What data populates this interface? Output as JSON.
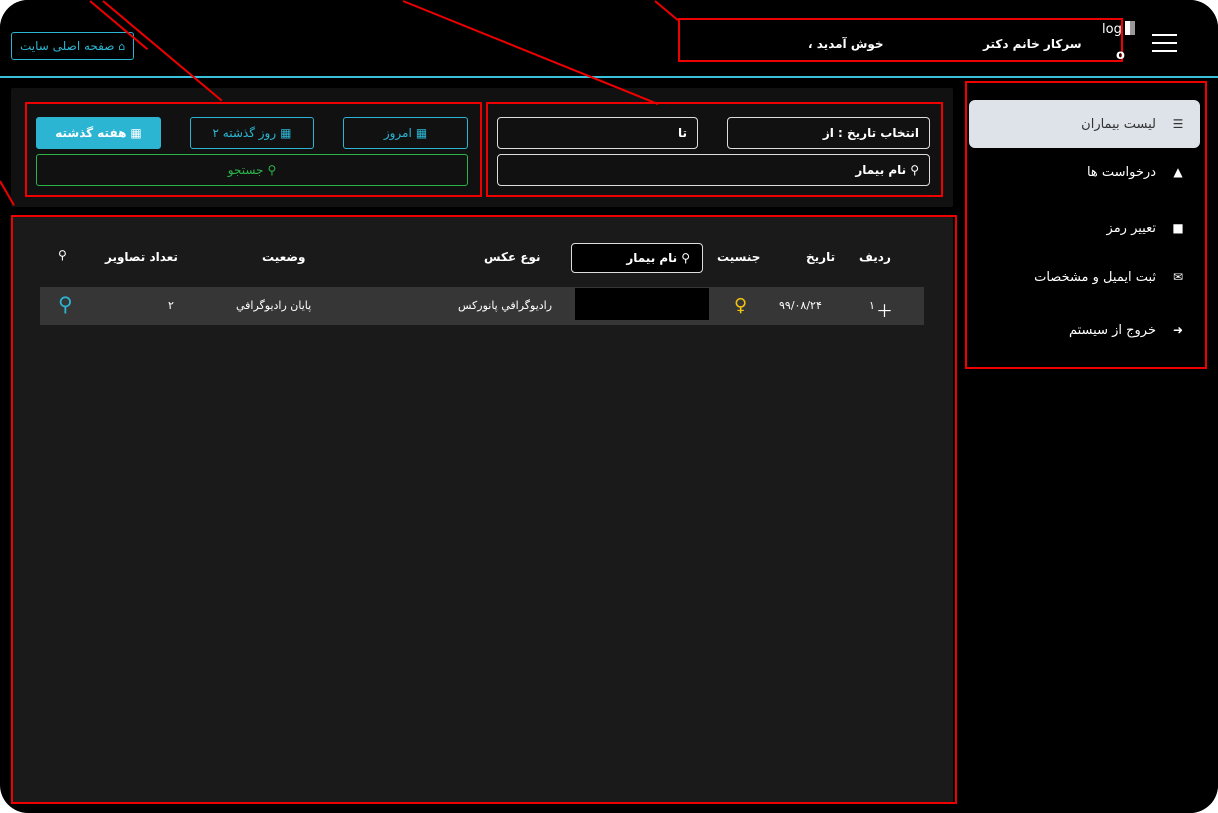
{
  "header": {
    "home_label": "صفحه اصلی سایت",
    "welcome": "، خوش آمدید",
    "user_name": "سرکار خانم دکتر",
    "logo_text": "log",
    "logo_o": "o"
  },
  "filters": {
    "date_from_label": "انتخاب تاریخ : از",
    "date_to_label": "تا",
    "patient_name_label": "نام بیمار",
    "today_label": "امروز",
    "two_days_label": "۲ روز گذشته",
    "week_label": "هفته گذشته",
    "search_label": "جستجو"
  },
  "table": {
    "headers": {
      "row": "ردیف",
      "date": "تاریخ",
      "gender": "جنسیت",
      "patient_name_filter": "نام بیمار",
      "photo_type": "نوع عکس",
      "status": "وضعیت",
      "images_count": "تعداد تصاویر"
    },
    "rows": [
      {
        "index": "۱",
        "date": "۹۹/۰۸/۲۴",
        "photo_type": "راديوگرافي پانورکس",
        "status": "پايان راديوگرافي",
        "images_count": "۲"
      }
    ]
  },
  "sidebar": {
    "items": [
      {
        "label": "لیست بیماران",
        "icon": "list-icon"
      },
      {
        "label": "درخواست ها",
        "icon": "bell-icon"
      },
      {
        "label": "تعییر رمز",
        "icon": "unlock-icon"
      },
      {
        "label": "ثبت ایمیل و مشخصات",
        "icon": "envelope-icon"
      },
      {
        "label": "خروج از سیستم",
        "icon": "sign-out-icon"
      }
    ]
  },
  "colors": {
    "accent": "#2cb5d2",
    "search": "#2bb34a",
    "annotation": "#ee0000"
  }
}
